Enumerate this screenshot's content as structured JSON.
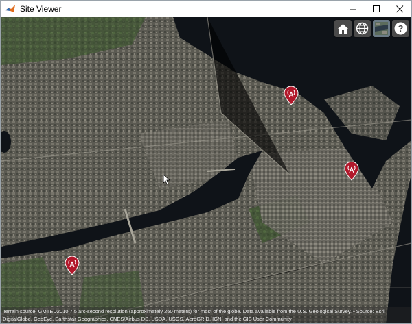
{
  "window": {
    "title": "Site Viewer"
  },
  "toolbar": {
    "buttons": [
      {
        "name": "home-button",
        "icon": "home-icon"
      },
      {
        "name": "base-layer-button",
        "icon": "globe-icon"
      },
      {
        "name": "scene-mode-button",
        "icon": "map-view-icon"
      },
      {
        "name": "help-button",
        "icon": "help-icon",
        "label": "?"
      }
    ]
  },
  "markers": [
    {
      "name": "site-marker-1",
      "icon": "antenna-icon"
    },
    {
      "name": "site-marker-2",
      "icon": "antenna-icon"
    },
    {
      "name": "site-marker-3",
      "icon": "antenna-icon"
    }
  ],
  "attribution": {
    "text": "Terrain source: GMTED2010 7.5 arc-second resolution (approximately 250 meters) for most of the globe. Data available from the U.S. Geological Survey. • Source: Esri, DigitalGlobe, GeoEye, Earthstar Geographics, CNES/Airbus DS, USDA, USGS, AeroGRID, IGN, and the GIS User Community"
  },
  "colors": {
    "marker": "#b2182b",
    "toolbar_bg": "#4a4a4a",
    "water": "#0f1318"
  }
}
